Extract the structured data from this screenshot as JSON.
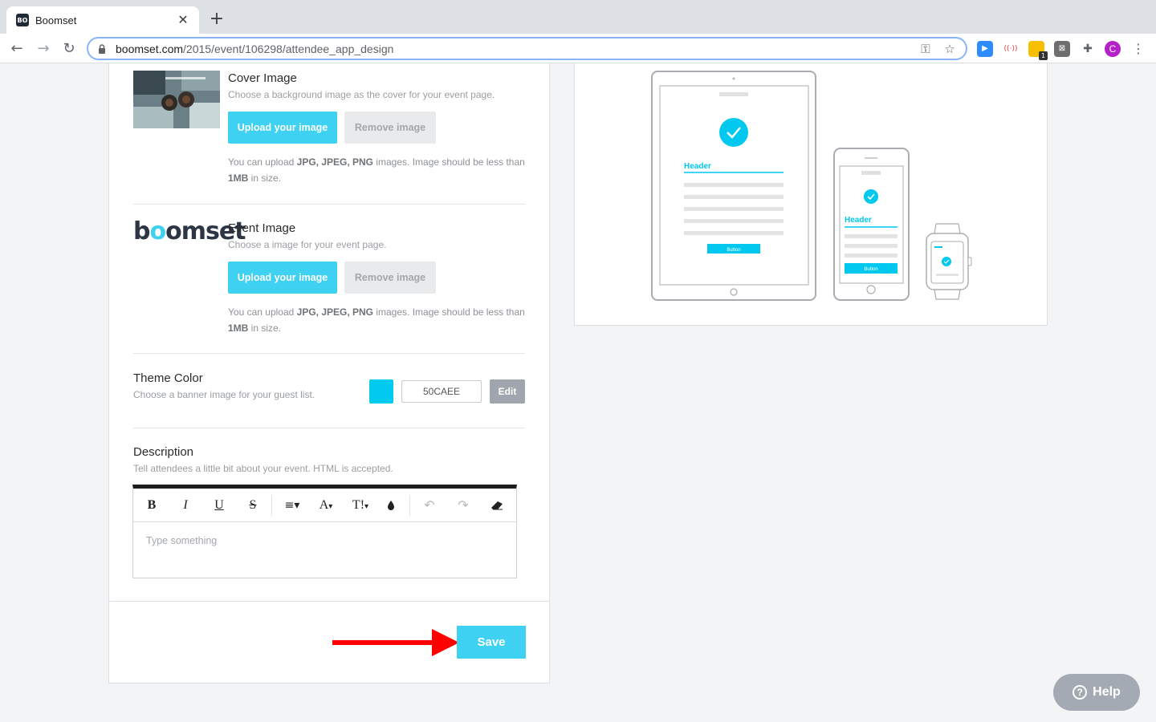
{
  "browser": {
    "tab_title": "Boomset",
    "favicon_text": "BO",
    "url_host": "boomset.com",
    "url_path": "/2015/event/106298/attendee_app_design",
    "profile_initial": "C",
    "ext_badge": "1"
  },
  "cover_image": {
    "title": "Cover Image",
    "subtitle": "Choose a background image as the cover for your event page.",
    "upload_label": "Upload your image",
    "remove_label": "Remove image",
    "note_prefix": "You can upload ",
    "note_formats": "JPG, JPEG, PNG",
    "note_middle": " images. Image should be less than ",
    "note_size": "1MB",
    "note_suffix": " in size."
  },
  "event_image": {
    "logo_text_1": "b",
    "logo_text_2": "o",
    "logo_text_3": "omset",
    "title": "Event Image",
    "subtitle": "Choose a image for your event page.",
    "upload_label": "Upload your image",
    "remove_label": "Remove image",
    "note_prefix": "You can upload ",
    "note_formats": "JPG, JPEG, PNG",
    "note_middle": " images. Image should be less than ",
    "note_size": "1MB",
    "note_suffix": " in size."
  },
  "theme_color": {
    "title": "Theme Color",
    "subtitle": "Choose a banner image for your guest list.",
    "value": "50CAEE",
    "swatch_color": "#00cbee",
    "edit_label": "Edit"
  },
  "description": {
    "title": "Description",
    "subtitle": "Tell attendees a little bit about your event. HTML is accepted.",
    "placeholder": "Type something",
    "toolbar": {
      "bold": "B",
      "italic": "I",
      "underline": "U",
      "strike": "S",
      "font": "A",
      "size": "T!"
    }
  },
  "footer": {
    "save_label": "Save"
  },
  "preview": {
    "tablet_header": "Header",
    "tablet_button": "Button",
    "phone_header": "Header",
    "phone_button": "Button"
  },
  "help": {
    "label": "Help"
  },
  "colors": {
    "accent": "#3ed1f2",
    "preview_accent": "#00c8ef",
    "arrow": "#ff0000"
  }
}
